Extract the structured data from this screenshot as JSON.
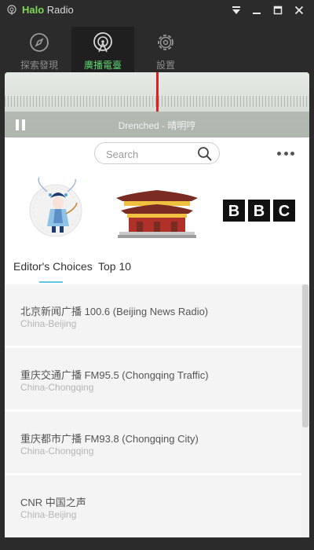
{
  "app": {
    "title_part1": "Halo",
    "title_part2": " Radio"
  },
  "nav": [
    {
      "label": "探索發現",
      "icon": "compass-icon",
      "active": false
    },
    {
      "label": "廣播電臺",
      "icon": "radio-antenna-icon",
      "active": true
    },
    {
      "label": "設置",
      "icon": "gear-icon",
      "active": false
    }
  ],
  "player": {
    "now_playing": "Drenched - 晴明哼"
  },
  "search": {
    "placeholder": "Search"
  },
  "featured": [
    {
      "name": "peking-opera-card",
      "icon": "peking-opera-figure-icon"
    },
    {
      "name": "forbidden-city-card",
      "icon": "chinese-palace-icon"
    },
    {
      "name": "bbc-card",
      "icon": "bbc-logo-icon",
      "letters": [
        "B",
        "B",
        "C"
      ]
    }
  ],
  "tabs": {
    "editors_choices": "Editor's Choices",
    "top10": "Top 10"
  },
  "stations": [
    {
      "title": "北京新闻广播 100.6 (Beijing News Radio)",
      "location": "China-Beijing"
    },
    {
      "title": "重庆交通广播 FM95.5 (Chongqing Traffic)",
      "location": "China-Chongqing"
    },
    {
      "title": "重庆都市广播 FM93.8 (Chongqing City)",
      "location": "China-Chongqing"
    },
    {
      "title": "CNR 中国之声",
      "location": "China-Beijing"
    }
  ],
  "colors": {
    "accent_green": "#5fd16f",
    "needle_red": "#e02020",
    "tab_underline": "#5fc6e0"
  }
}
